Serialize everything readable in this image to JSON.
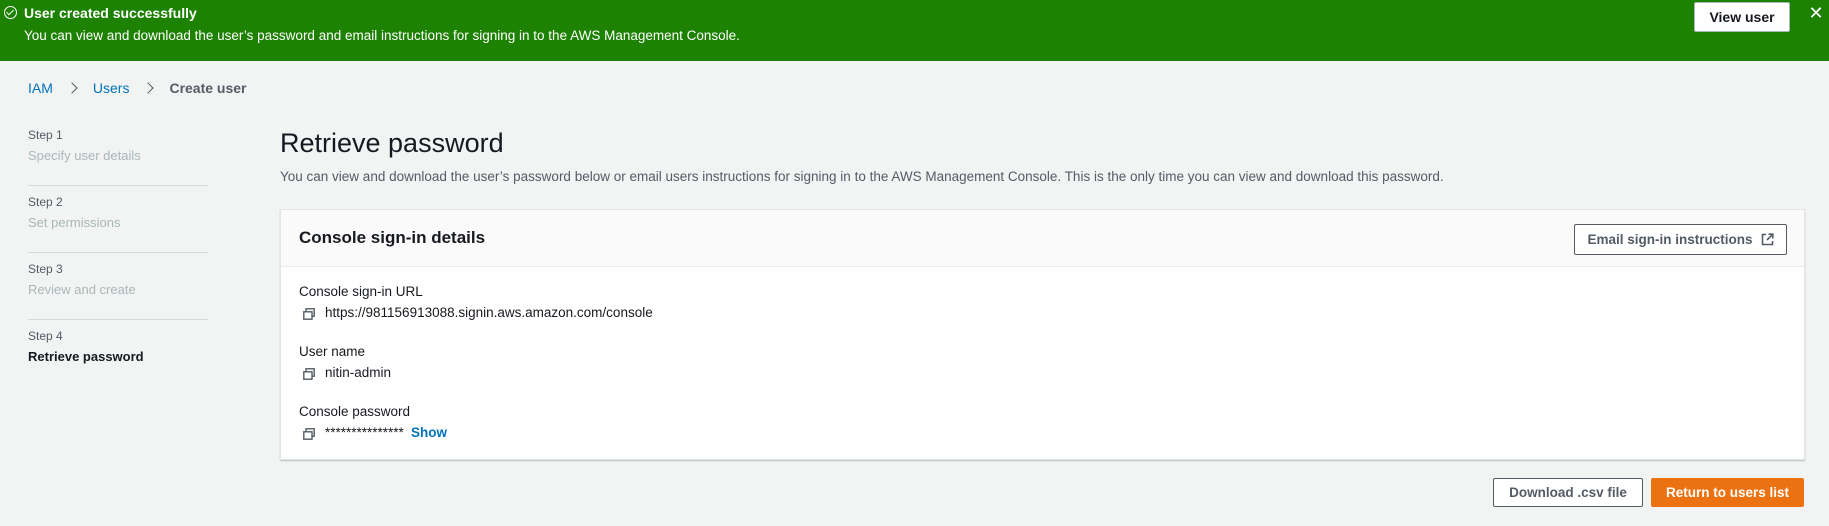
{
  "flash": {
    "title": "User created successfully",
    "message": "You can view and download the user’s password and email instructions for signing in to the AWS Management Console.",
    "view_user_label": "View user",
    "close_glyph": "✕",
    "icon": "success-check-icon",
    "color": "#1d8102"
  },
  "breadcrumb": {
    "items": [
      {
        "label": "IAM"
      },
      {
        "label": "Users"
      },
      {
        "label": "Create user"
      }
    ]
  },
  "steps": [
    {
      "number": "Step 1",
      "label": "Specify user details"
    },
    {
      "number": "Step 2",
      "label": "Set permissions"
    },
    {
      "number": "Step 3",
      "label": "Review and create"
    },
    {
      "number": "Step 4",
      "label": "Retrieve password"
    }
  ],
  "main": {
    "title": "Retrieve password",
    "description": "You can view and download the user’s password below or email users instructions for signing in to the AWS Management Console. This is the only time you can view and download this password."
  },
  "panel": {
    "title": "Console sign-in details",
    "email_button_label": "Email sign-in instructions",
    "fields": [
      {
        "label": "Console sign-in URL",
        "value": "https://981156913088.signin.aws.amazon.com/console"
      },
      {
        "label": "User name",
        "value": "nitin-admin"
      },
      {
        "label": "Console password",
        "value": "***************",
        "show_label": "Show"
      }
    ]
  },
  "actions": {
    "download_label": "Download .csv file",
    "return_label": "Return to users list",
    "primary_color": "#ec7211"
  }
}
